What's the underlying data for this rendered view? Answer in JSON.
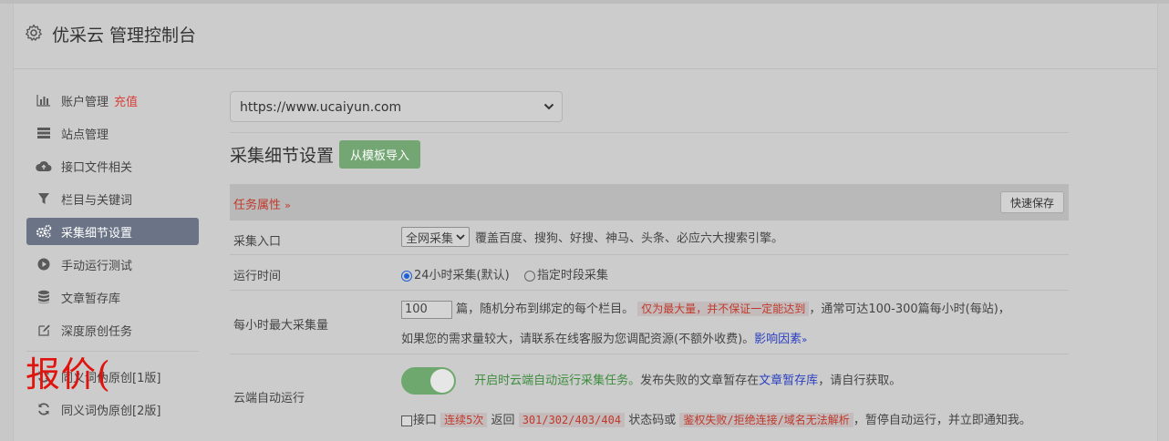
{
  "header": {
    "title": "优采云 管理控制台"
  },
  "stamp": "报价(",
  "sidebar": {
    "items": [
      {
        "label": "账户管理",
        "extra": "充值"
      },
      {
        "label": "站点管理"
      },
      {
        "label": "接口文件相关"
      },
      {
        "label": "栏目与关键词"
      },
      {
        "label": "采集细节设置"
      },
      {
        "label": "手动运行测试"
      },
      {
        "label": "文章暂存库"
      },
      {
        "label": "深度原创任务"
      },
      {
        "label": "同义词伪原创[1版]"
      },
      {
        "label": "同义词伪原创[2版]"
      }
    ]
  },
  "site_select": {
    "value": "https://www.ucaiyun.com"
  },
  "section": {
    "title": "采集细节设置",
    "import_button": "从模板导入"
  },
  "table": {
    "attr_label": "任务属性",
    "save_button": "快速保存",
    "rows": {
      "entry": {
        "label": "采集入口",
        "select_value": "全网采集",
        "desc": "覆盖百度、搜狗、好搜、神马、头条、必应六大搜索引擎。"
      },
      "time": {
        "label": "运行时间",
        "opt1": "24小时采集(默认)",
        "opt2": "指定时段采集"
      },
      "max": {
        "label": "每小时最大采集量",
        "input_value": "100",
        "text1": "篇，随机分布到绑定的每个栏目。",
        "warn": "仅为最大量，并不保证一定能达到",
        "text2": "，通常可达100-300篇每小时(每站)，",
        "text3": "如果您的需求量较大，请联系在线客服为您调配资源(不额外收费)。",
        "link": "影响因素"
      },
      "cloud": {
        "label": "云端自动运行",
        "green": "开启时云端自动运行采集任务。",
        "text1": "发布失败的文章暂存在",
        "link": "文章暂存库",
        "text2": "，请自行获取。",
        "cb_label": "接口",
        "c1": "连续5次",
        "t1": "返回",
        "c2": "301/302/403/404",
        "t2": "状态码或",
        "c3": "鉴权失败/拒绝连接/域名无法解析",
        "t3": "，暂停自动运行，并立即通知我。"
      }
    }
  }
}
